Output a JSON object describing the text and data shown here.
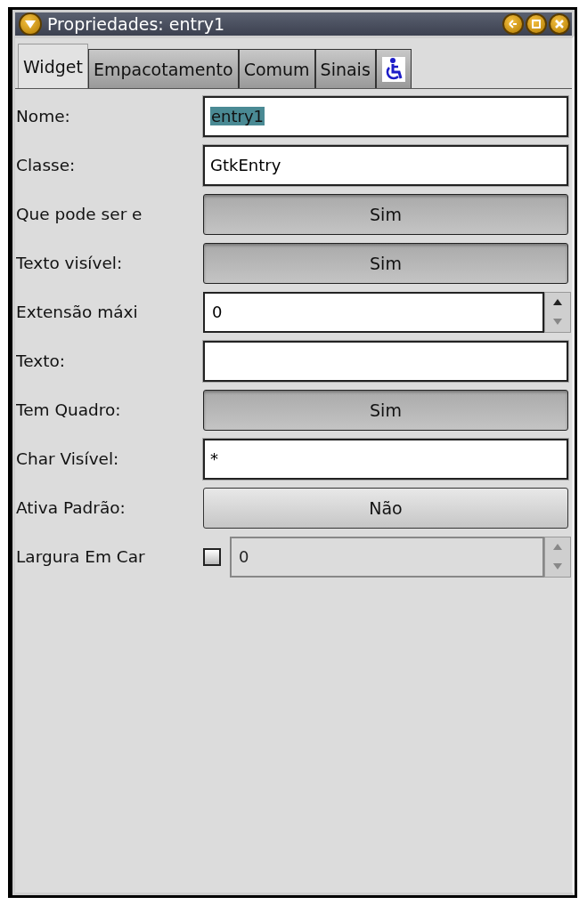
{
  "window": {
    "title": "Propriedades: entry1"
  },
  "tabs": [
    {
      "label": "Widget",
      "selected": true,
      "kind": "text"
    },
    {
      "label": "Empacotamento",
      "selected": false,
      "kind": "text"
    },
    {
      "label": "Comum",
      "selected": false,
      "kind": "text"
    },
    {
      "label": "Sinais",
      "selected": false,
      "kind": "text"
    },
    {
      "selected": false,
      "kind": "accessibility"
    }
  ],
  "properties": [
    {
      "label": "Nome:",
      "kind": "entry",
      "value": "entry1",
      "text_selected": true
    },
    {
      "label": "Classe:",
      "kind": "entry",
      "value": "GtkEntry"
    },
    {
      "label": "Que pode ser e",
      "kind": "toggle",
      "value": "Sim",
      "on": true
    },
    {
      "label": "Texto visível:",
      "kind": "toggle",
      "value": "Sim",
      "on": true
    },
    {
      "label": "Extensão máxi",
      "kind": "spin",
      "value": "0",
      "disabled": false
    },
    {
      "label": "Texto:",
      "kind": "entry"
    },
    {
      "label": "Tem Quadro:",
      "kind": "toggle",
      "value": "Sim",
      "on": true
    },
    {
      "label": "Char Visível:",
      "kind": "entry",
      "value": "*"
    },
    {
      "label": "Ativa Padrão:",
      "kind": "toggle",
      "value": "Não",
      "on": false
    },
    {
      "label": "Largura Em Car",
      "kind": "checkspin",
      "checked": false,
      "value": "0",
      "disabled": true
    }
  ]
}
